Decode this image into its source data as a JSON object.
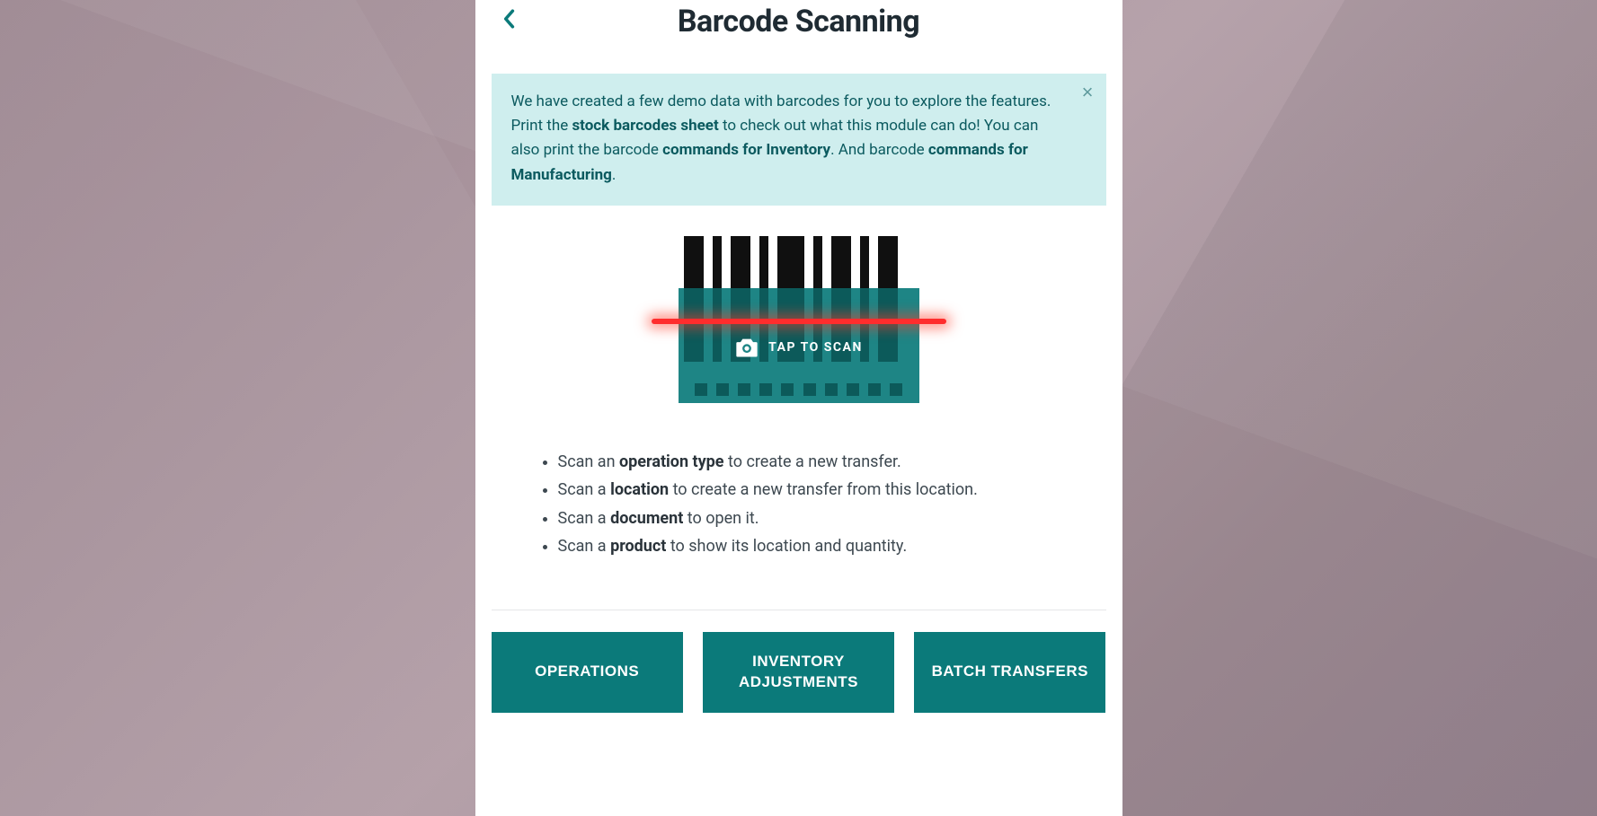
{
  "header": {
    "title": "Barcode Scanning"
  },
  "alert": {
    "text_1": "We have created a few demo data with barcodes for you to explore the features. Print the ",
    "link_1": "stock barcodes sheet",
    "text_2": " to check out what this module can do! You can also print the barcode ",
    "link_2": "commands for Inventory",
    "text_3": ". And barcode ",
    "link_3": "commands for Manufacturing",
    "text_4": "."
  },
  "scan": {
    "tap_label": "TAP TO SCAN"
  },
  "instructions": [
    {
      "pre": "Scan an ",
      "bold": "operation type",
      "post": " to create a new transfer."
    },
    {
      "pre": "Scan a ",
      "bold": "location",
      "post": " to create a new transfer from this location."
    },
    {
      "pre": "Scan a ",
      "bold": "document",
      "post": " to open it."
    },
    {
      "pre": "Scan a ",
      "bold": "product",
      "post": " to show its location and quantity."
    }
  ],
  "buttons": {
    "operations": "OPERATIONS",
    "inventory_adjustments": "INVENTORY ADJUSTMENTS",
    "batch_transfers": "BATCH TRANSFERS"
  }
}
